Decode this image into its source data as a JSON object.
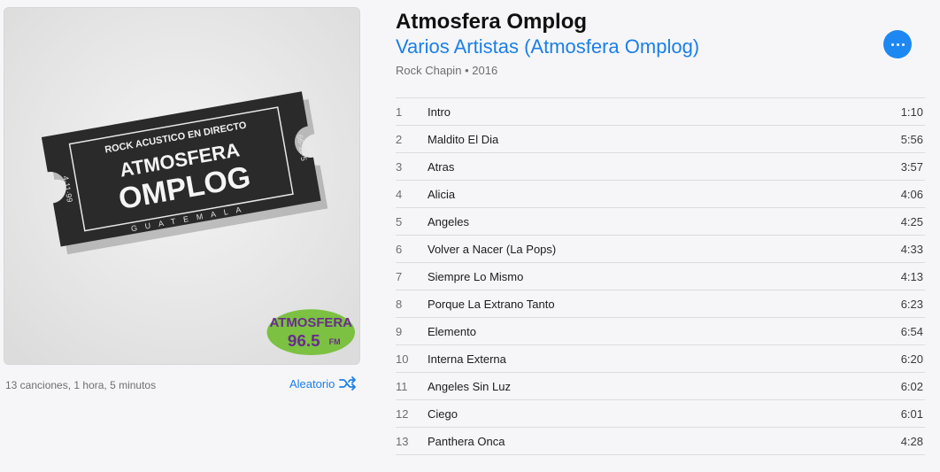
{
  "album": {
    "title": "Atmosfera Omplog",
    "artist": "Varios Artistas (Atmosfera Omplog)",
    "genre": "Rock Chapin",
    "separator": "•",
    "year": "2016",
    "summary": "13 canciones, 1 hora, 5 minutos",
    "shuffle_label": "Aleatorio",
    "cover": {
      "ticket_header": "ROCK ACUSTICO EN DIRECTO",
      "ticket_line1": "ATMOSFERA",
      "ticket_line2": "OMPLOG",
      "ticket_footer": "GUATEMALA",
      "ticket_date_left": "4·11·99",
      "ticket_date_right": "66·11·5",
      "logo_line1": "ATMOSFERA",
      "logo_line2": "96.5",
      "logo_suffix": "FM"
    }
  },
  "colors": {
    "accent": "#1a7fe8",
    "background": "#f6f6f8",
    "logo_green": "#7cc142",
    "logo_purple": "#6a2c8f"
  },
  "icons": {
    "more": "ellipsis-icon",
    "shuffle": "shuffle-icon"
  },
  "tracks": [
    {
      "num": "1",
      "name": "Intro",
      "duration": "1:10"
    },
    {
      "num": "2",
      "name": "Maldito El Dia",
      "duration": "5:56"
    },
    {
      "num": "3",
      "name": "Atras",
      "duration": "3:57"
    },
    {
      "num": "4",
      "name": "Alicia",
      "duration": "4:06"
    },
    {
      "num": "5",
      "name": "Angeles",
      "duration": "4:25"
    },
    {
      "num": "6",
      "name": "Volver a Nacer (La Pops)",
      "duration": "4:33"
    },
    {
      "num": "7",
      "name": "Siempre Lo Mismo",
      "duration": "4:13"
    },
    {
      "num": "8",
      "name": "Porque La Extrano Tanto",
      "duration": "6:23"
    },
    {
      "num": "9",
      "name": "Elemento",
      "duration": "6:54"
    },
    {
      "num": "10",
      "name": "Interna Externa",
      "duration": "6:20"
    },
    {
      "num": "11",
      "name": "Angeles Sin Luz",
      "duration": "6:02"
    },
    {
      "num": "12",
      "name": "Ciego",
      "duration": "6:01"
    },
    {
      "num": "13",
      "name": "Panthera Onca",
      "duration": "4:28"
    }
  ]
}
